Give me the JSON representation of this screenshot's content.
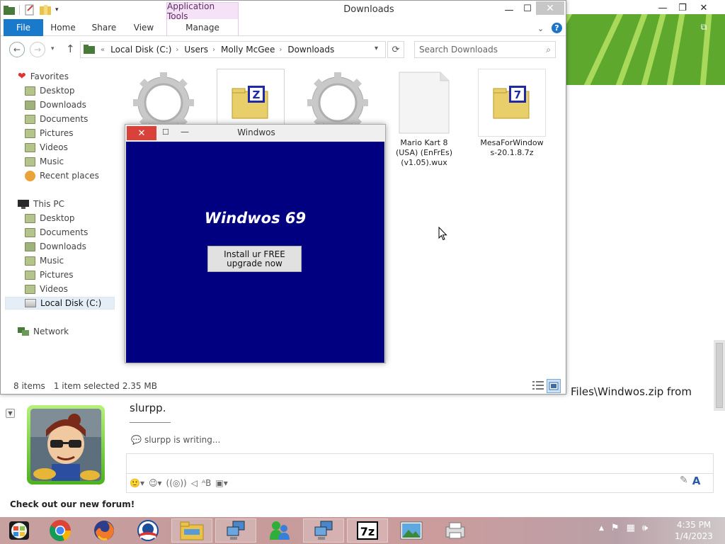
{
  "explorer": {
    "title": "Downloads",
    "context_tab": "Application Tools",
    "tabs": [
      "File",
      "Home",
      "Share",
      "View",
      "Manage"
    ],
    "address": {
      "prefix": "«",
      "crumbs": [
        "Local Disk (C:)",
        "Users",
        "Molly McGee",
        "Downloads"
      ]
    },
    "search_placeholder": "Search Downloads",
    "nav": {
      "favorites_header": "Favorites",
      "favorites": [
        "Desktop",
        "Downloads",
        "Documents",
        "Pictures",
        "Videos",
        "Music",
        "Recent places"
      ],
      "thispc_header": "This PC",
      "thispc": [
        "Desktop",
        "Documents",
        "Downloads",
        "Music",
        "Pictures",
        "Videos",
        "Local Disk (C:)"
      ],
      "network": "Network"
    },
    "files": [
      {
        "name": "",
        "icon": "gear-setup-icon"
      },
      {
        "name": "",
        "icon": "zip-archive-icon"
      },
      {
        "name": "",
        "icon": "gear-setup-icon"
      },
      {
        "name": "Mario Kart 8 (USA) (EnFrEs) (v1.05).wux",
        "icon": "blank-file-icon"
      },
      {
        "name": "MesaForWindows-20.1.8.7z",
        "icon": "7z-archive-icon"
      }
    ],
    "status": {
      "items": "8 items",
      "selected": "1 item selected",
      "size": "2.35 MB"
    }
  },
  "popup": {
    "title": "Windwos",
    "heading": "Windwos 69",
    "button": "Install ur FREE upgrade now",
    "faint_text": "..."
  },
  "chat": {
    "message_tail": "Files\\Windwos.zip from",
    "message_cont": "slurpp.",
    "writing": "slurpp is writing...",
    "forum": "Check out our new forum!",
    "toolbar": [
      "emoticon-icon",
      "wink-icon",
      "nudge-icon",
      "voice-clip-icon",
      "font-icon",
      "games-icon"
    ]
  },
  "taskbar": {
    "apps": [
      "Windows 7 start orb",
      "Google Chrome",
      "Firefox",
      "Obama logo",
      "File Explorer",
      "Network remote",
      "MSN Messenger",
      "Network remote 2",
      "7-Zip",
      "Photos",
      "Print"
    ],
    "time": "4:35 PM",
    "date": "1/4/2023"
  },
  "colors": {
    "file_blue": "#1979ca",
    "popup_bg": "#000080",
    "close_red": "#d8423a"
  }
}
